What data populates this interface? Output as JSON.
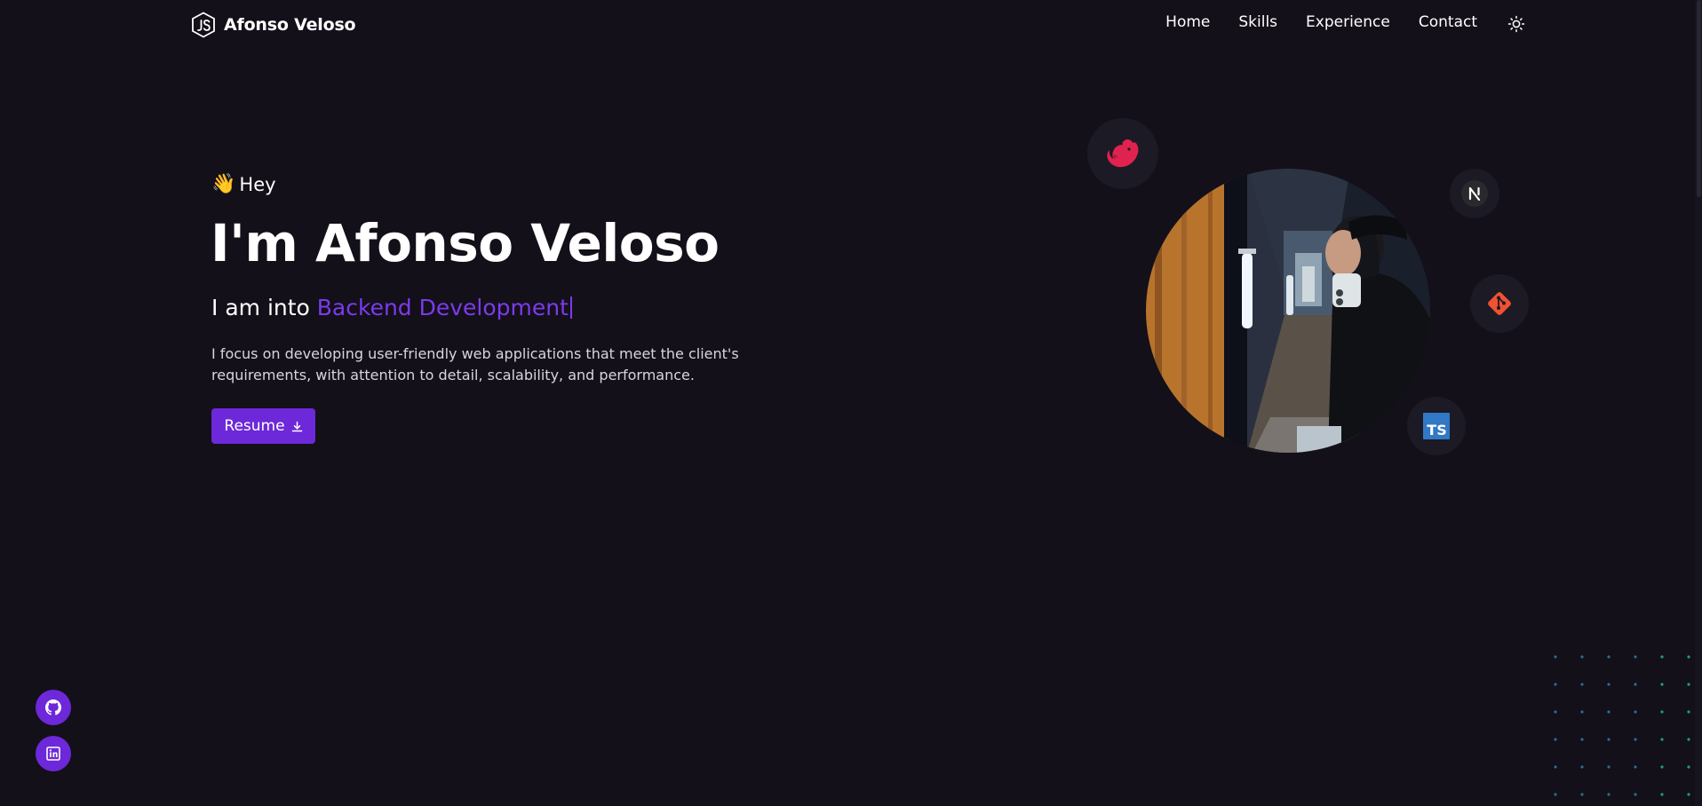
{
  "brand": {
    "name": "Afonso Veloso",
    "logo_icon": "js-hexagon-icon"
  },
  "nav": {
    "items": [
      {
        "label": "Home"
      },
      {
        "label": "Skills"
      },
      {
        "label": "Experience"
      },
      {
        "label": "Contact"
      }
    ],
    "theme_toggle_icon": "sun-icon"
  },
  "hero": {
    "greeting_emoji": "👋",
    "greeting": "Hey",
    "title": "I'm Afonso Veloso",
    "subtitle_prefix": "I am into",
    "subtitle_typed": "Backend Development",
    "description": "I focus on developing user-friendly web applications that meet the client's requirements, with attention to detail, scalability, and performance.",
    "resume_label": "Resume",
    "resume_icon": "download-icon"
  },
  "tech_icons": [
    "nestjs-icon",
    "nextjs-icon",
    "git-icon",
    "typescript-icon"
  ],
  "ts_icon_text": "TS",
  "socials": [
    "github-icon",
    "linkedin-icon"
  ],
  "colors": {
    "background": "#131019",
    "accent": "#7c3aed",
    "button": "#6d28d9",
    "nest": "#e0234e",
    "git": "#f05133",
    "typescript": "#3178c6"
  }
}
